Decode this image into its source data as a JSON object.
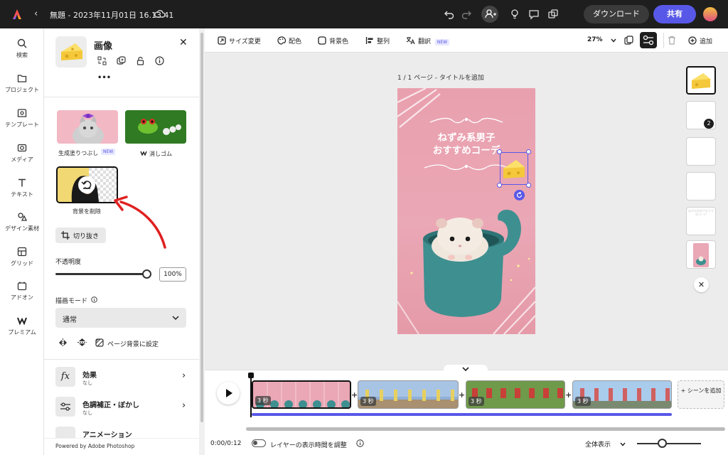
{
  "header": {
    "doc_title": "無題 - 2023年11月01日 16.13.41",
    "download_label": "ダウンロード",
    "share_label": "共有"
  },
  "leftnav": {
    "items": [
      {
        "label": "検索",
        "icon": "search-icon"
      },
      {
        "label": "プロジェクト",
        "icon": "folder-icon"
      },
      {
        "label": "テンプレート",
        "icon": "template-icon"
      },
      {
        "label": "メディア",
        "icon": "media-icon"
      },
      {
        "label": "テキスト",
        "icon": "text-icon"
      },
      {
        "label": "デザイン素材",
        "icon": "shapes-icon"
      },
      {
        "label": "グリッド",
        "icon": "grid-icon"
      },
      {
        "label": "アドオン",
        "icon": "addon-icon"
      },
      {
        "label": "プレミアム",
        "icon": "premium-icon"
      }
    ]
  },
  "panel": {
    "title": "画像",
    "more": "•••",
    "tools": [
      {
        "label": "生成塗りつぶし",
        "badge": "NEW"
      },
      {
        "label": "消しゴム"
      },
      {
        "label": "背景を削除"
      }
    ],
    "crop_label": "切り抜き",
    "opacity_label": "不透明度",
    "opacity_value": "100%",
    "opacity_fraction": 1.0,
    "blend_label": "描画モード",
    "blend_value": "通常",
    "page_bg_label": "ページ背景に設定",
    "sections": [
      {
        "title": "効果",
        "sub": "なし"
      },
      {
        "title": "色調補正・ぼかし",
        "sub": "なし"
      },
      {
        "title": "アニメーション",
        "sub": ""
      }
    ],
    "powered_by": "Powered by Adobe Photoshop"
  },
  "toolbar": {
    "resize": "サイズ変更",
    "color": "配色",
    "bgcolor": "背景色",
    "arrange": "整列",
    "translate": "翻訳",
    "translate_badge": "NEW",
    "zoom": "27%",
    "add": "追加"
  },
  "canvas": {
    "page_label": "1 / 1 ページ - タイトルを追加",
    "headline_line1": "ねずみ系男子",
    "headline_line2": "おすすめコーデ"
  },
  "pages": {
    "badge_count": "2",
    "thumb4_text": "ねずみ系男子おすすめコーデ"
  },
  "timeline": {
    "clips": [
      {
        "duration": "3 秒"
      },
      {
        "duration": "3 秒"
      },
      {
        "duration": "3 秒"
      },
      {
        "duration": "3 秒"
      }
    ],
    "add_scene": "+ シーンを追加",
    "time": "0:00/0:12",
    "layer_toggle_label": "レイヤーの表示時間を調整",
    "view_all": "全体表示"
  },
  "colors": {
    "accent": "#5858e8",
    "topbar": "#1e1e1e",
    "annotation": "#e02020"
  }
}
